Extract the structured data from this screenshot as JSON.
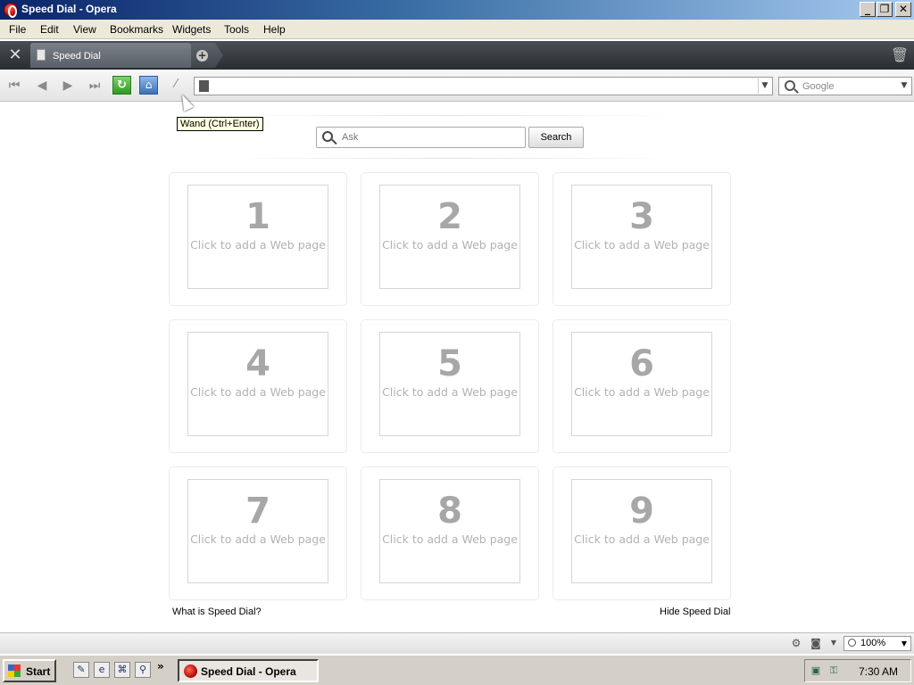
{
  "window": {
    "title": "Speed Dial - Opera"
  },
  "menu": [
    "File",
    "Edit",
    "View",
    "Bookmarks",
    "Widgets",
    "Tools",
    "Help"
  ],
  "tab": {
    "label": "Speed Dial"
  },
  "address": {
    "value": ""
  },
  "search_engine": {
    "placeholder": "Google"
  },
  "tooltip": "Wand (Ctrl+Enter)",
  "speed_dial": {
    "ask_placeholder": "Ask",
    "search_button": "Search",
    "dials": [
      {
        "num": "1",
        "text": "Click to add a Web page"
      },
      {
        "num": "2",
        "text": "Click to add a Web page"
      },
      {
        "num": "3",
        "text": "Click to add a Web page"
      },
      {
        "num": "4",
        "text": "Click to add a Web page"
      },
      {
        "num": "5",
        "text": "Click to add a Web page"
      },
      {
        "num": "6",
        "text": "Click to add a Web page"
      },
      {
        "num": "7",
        "text": "Click to add a Web page"
      },
      {
        "num": "8",
        "text": "Click to add a Web page"
      },
      {
        "num": "9",
        "text": "Click to add a Web page"
      }
    ],
    "what_is_link": "What is Speed Dial?",
    "hide_link": "Hide Speed Dial"
  },
  "statusbar": {
    "zoom": "100%"
  },
  "taskbar": {
    "start": "Start",
    "task": "Speed Dial - Opera",
    "clock": "7:30 AM"
  },
  "icons": {
    "back": "rewind-icon",
    "prev": "back-arrow-icon",
    "next": "forward-arrow-icon",
    "ffwd": "fast-forward-icon",
    "reload": "reload-icon",
    "home": "home-icon",
    "wand": "wand-icon",
    "trash": "trash-icon",
    "tools": "tools-icon"
  },
  "colors": {
    "title_gradient_start": "#0a246a",
    "dial_number": "#a7a7a7",
    "dial_text": "#b2b2b2"
  }
}
